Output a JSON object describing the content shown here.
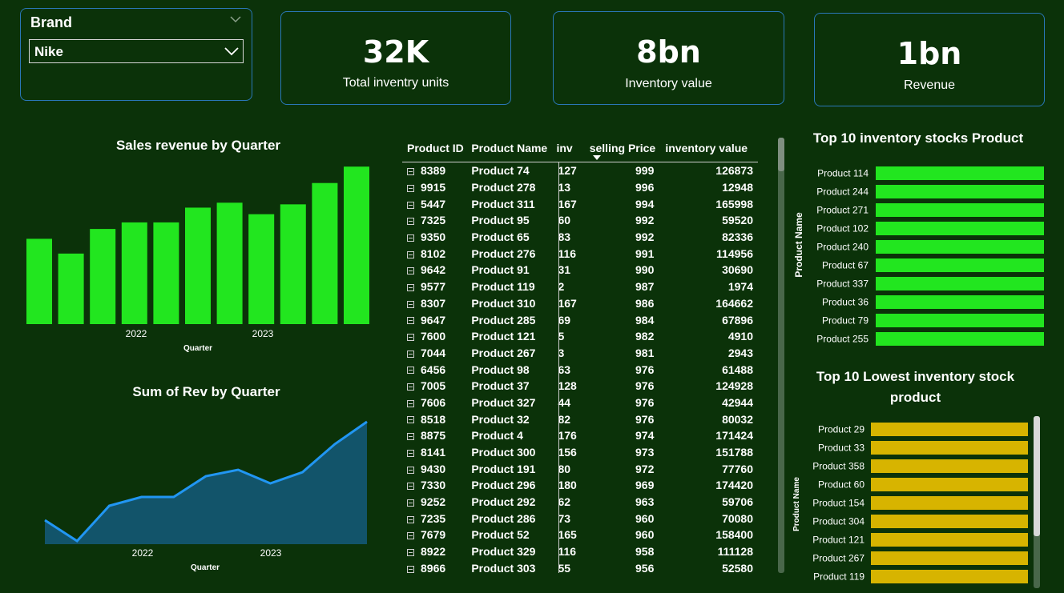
{
  "slicer": {
    "title": "Brand",
    "selected": "Nike"
  },
  "kpis": [
    {
      "value": "32K",
      "label": "Total inventry units"
    },
    {
      "value": "8bn",
      "label": "Inventory value"
    },
    {
      "value": "1bn",
      "label": "Revenue"
    }
  ],
  "colors": {
    "background": "#0b3209",
    "green_bar": "#22e61f",
    "yellow_bar": "#d7b400",
    "area_line": "#2196f3",
    "area_fill": "#12546a",
    "card_border": "#2a77b8"
  },
  "chart_data": [
    {
      "type": "bar",
      "title": "Sales revenue by Quarter",
      "xlabel": "Quarter",
      "tick_labels": [
        "2022",
        "2023"
      ],
      "values": [
        52,
        43,
        58,
        62,
        62,
        71,
        74,
        67,
        73,
        86,
        96
      ],
      "ylim": [
        0,
        100
      ]
    },
    {
      "type": "area",
      "title": "Sum of Rev by Quarter",
      "xlabel": "Quarter",
      "tick_labels": [
        "2022",
        "2023"
      ],
      "values": [
        30,
        4,
        48,
        59,
        59,
        85,
        93,
        76,
        90,
        125,
        153
      ],
      "ylim": [
        0,
        160
      ]
    },
    {
      "type": "bar",
      "orientation": "horizontal",
      "title": "Top 10 inventory stocks Product",
      "ylabel": "Product Name",
      "categories": [
        "Product 114",
        "Product 244",
        "Product 271",
        "Product 102",
        "Product 240",
        "Product 67",
        "Product 337",
        "Product 36",
        "Product 79",
        "Product 255"
      ],
      "values": [
        200,
        200,
        200,
        200,
        200,
        200,
        200,
        200,
        200,
        200
      ]
    },
    {
      "type": "bar",
      "orientation": "horizontal",
      "title_lines": [
        "Top 10 Lowest inventory stock",
        "product"
      ],
      "ylabel": "Product Name",
      "categories": [
        "Product 29",
        "Product 33",
        "Product 358",
        "Product 60",
        "Product 154",
        "Product 304",
        "Product 121",
        "Product 267",
        "Product 119"
      ],
      "values": [
        5,
        5,
        5,
        5,
        5,
        5,
        5,
        5,
        5
      ]
    }
  ],
  "table": {
    "headers": [
      "Product ID",
      "Product Name",
      "inv",
      "selling Price",
      "inventory value"
    ],
    "rows": [
      [
        "8389",
        "Product 74",
        "127",
        "999",
        "126873"
      ],
      [
        "9915",
        "Product 278",
        "13",
        "996",
        "12948"
      ],
      [
        "5447",
        "Product 311",
        "167",
        "994",
        "165998"
      ],
      [
        "7325",
        "Product 95",
        "60",
        "992",
        "59520"
      ],
      [
        "9350",
        "Product 65",
        "83",
        "992",
        "82336"
      ],
      [
        "8102",
        "Product 276",
        "116",
        "991",
        "114956"
      ],
      [
        "9642",
        "Product 91",
        "31",
        "990",
        "30690"
      ],
      [
        "9577",
        "Product 119",
        "2",
        "987",
        "1974"
      ],
      [
        "8307",
        "Product 310",
        "167",
        "986",
        "164662"
      ],
      [
        "9647",
        "Product 285",
        "69",
        "984",
        "67896"
      ],
      [
        "7600",
        "Product 121",
        "5",
        "982",
        "4910"
      ],
      [
        "7044",
        "Product 267",
        "3",
        "981",
        "2943"
      ],
      [
        "6456",
        "Product 98",
        "63",
        "976",
        "61488"
      ],
      [
        "7005",
        "Product 37",
        "128",
        "976",
        "124928"
      ],
      [
        "7606",
        "Product 327",
        "44",
        "976",
        "42944"
      ],
      [
        "8518",
        "Product 32",
        "82",
        "976",
        "80032"
      ],
      [
        "8875",
        "Product 4",
        "176",
        "974",
        "171424"
      ],
      [
        "8141",
        "Product 300",
        "156",
        "973",
        "151788"
      ],
      [
        "9430",
        "Product 191",
        "80",
        "972",
        "77760"
      ],
      [
        "7330",
        "Product 296",
        "180",
        "969",
        "174420"
      ],
      [
        "9252",
        "Product 292",
        "62",
        "963",
        "59706"
      ],
      [
        "7235",
        "Product 286",
        "73",
        "960",
        "70080"
      ],
      [
        "7679",
        "Product 52",
        "165",
        "960",
        "158400"
      ],
      [
        "8922",
        "Product 329",
        "116",
        "958",
        "111128"
      ],
      [
        "8966",
        "Product 303",
        "55",
        "956",
        "52580"
      ]
    ]
  }
}
